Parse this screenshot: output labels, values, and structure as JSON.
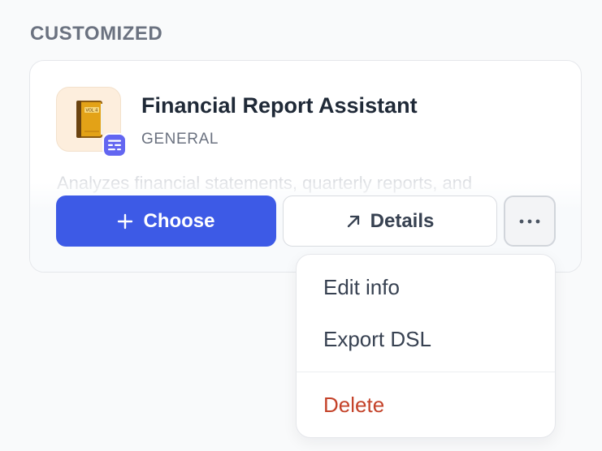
{
  "section": {
    "title": "CUSTOMIZED"
  },
  "app": {
    "title": "Financial Report Assistant",
    "category": "GENERAL",
    "description": "Analyzes financial statements, quarterly reports, and",
    "icon": "book-icon",
    "badge_icon": "workflow-icon",
    "icon_bg_color": "#fdeedd",
    "badge_color": "#6366f1"
  },
  "actions": {
    "choose_label": "Choose",
    "choose_icon": "plus-icon",
    "details_label": "Details",
    "details_icon": "arrow-up-right-icon",
    "more_icon": "more-horizontal-icon",
    "primary_color": "#3d5ae6"
  },
  "menu": {
    "items": [
      {
        "label": "Edit info"
      },
      {
        "label": "Export DSL"
      },
      {
        "label": "Delete",
        "color": "#c4432a"
      }
    ]
  }
}
